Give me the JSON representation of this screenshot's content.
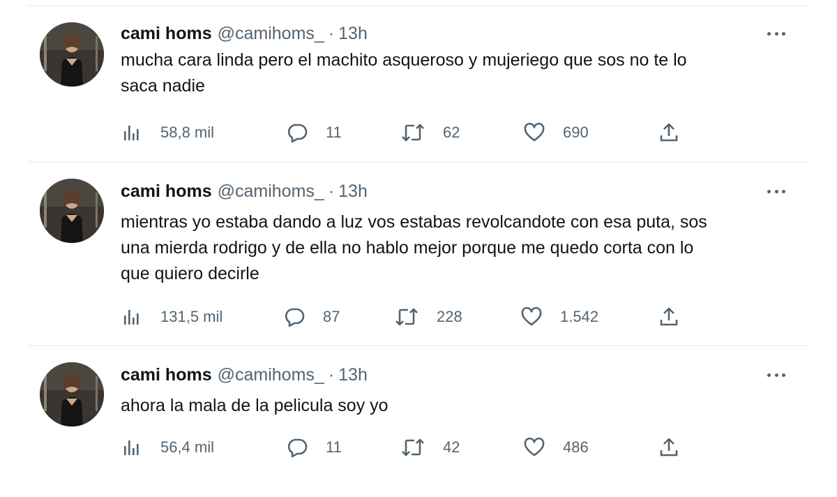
{
  "tweets": [
    {
      "name": "cami homs",
      "handle": "@camihoms_",
      "separator": "·",
      "time": "13h",
      "text_lines": [
        "mucha cara linda pero el machito asqueroso y mujeriego que sos no te lo",
        "saca nadie"
      ],
      "views": "58,8 mil",
      "replies": "11",
      "retweets": "62",
      "likes": "690"
    },
    {
      "name": "cami homs",
      "handle": "@camihoms_",
      "separator": "·",
      "time": "13h",
      "text_lines": [
        "mientras yo estaba dando a luz vos estabas revolcandote con esa puta, sos",
        "una mierda rodrigo y de ella no hablo mejor porque me quedo corta con lo",
        "que quiero decirle"
      ],
      "views": "131,5 mil",
      "replies": "87",
      "retweets": "228",
      "likes": "1.542"
    },
    {
      "name": "cami homs",
      "handle": "@camihoms_",
      "separator": "·",
      "time": "13h",
      "text_lines": [
        "ahora la mala de la pelicula soy yo"
      ],
      "views": "56,4 mil",
      "replies": "11",
      "retweets": "42",
      "likes": "486"
    }
  ],
  "icons": {
    "views": "views-bar-chart-icon",
    "reply": "reply-bubble-icon",
    "retweet": "retweet-arrows-icon",
    "like": "heart-icon",
    "share": "share-upload-icon",
    "more": "more-options-icon"
  },
  "colors": {
    "text": "#0f1419",
    "secondary": "#536471",
    "divider": "#eff3f4"
  }
}
